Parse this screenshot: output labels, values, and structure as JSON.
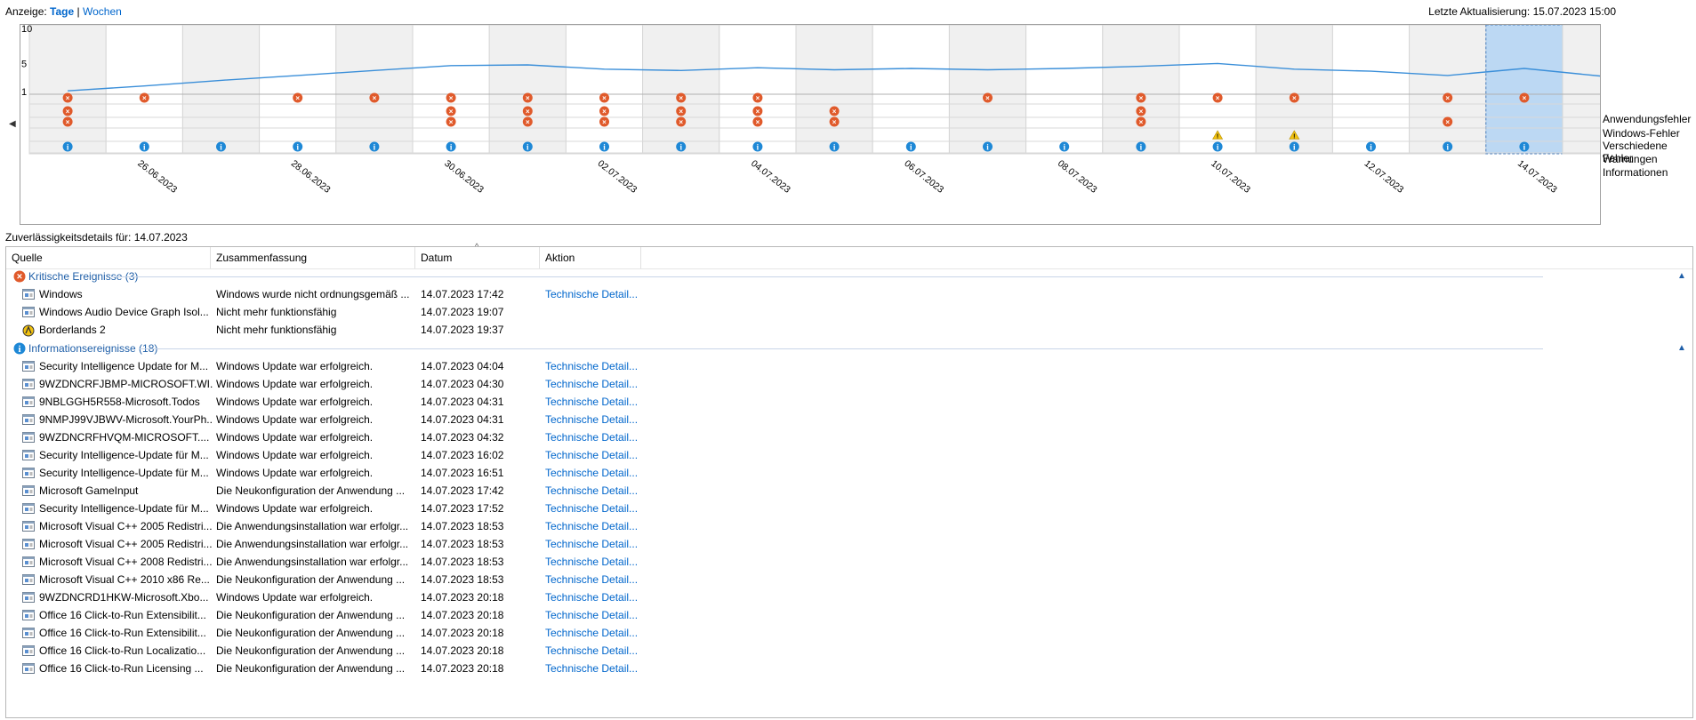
{
  "header": {
    "view_label": "Anzeige:",
    "view_days": "Tage",
    "view_sep": "|",
    "view_weeks": "Wochen",
    "last_update": "Letzte Aktualisierung: 15.07.2023 15:00"
  },
  "chart_data": {
    "type": "line",
    "y_ticks": [
      "10",
      "5",
      "1"
    ],
    "ylim": [
      1,
      10
    ],
    "x": [
      "25.06.2023",
      "26.06.2023",
      "27.06.2023",
      "28.06.2023",
      "29.06.2023",
      "30.06.2023",
      "01.07.2023",
      "02.07.2023",
      "03.07.2023",
      "04.07.2023",
      "05.07.2023",
      "06.07.2023",
      "07.07.2023",
      "08.07.2023",
      "09.07.2023",
      "10.07.2023",
      "11.07.2023",
      "12.07.2023",
      "13.07.2023",
      "14.07.2023",
      "15.07.2023"
    ],
    "x_tick_labels": [
      "26.06.2023",
      "28.06.2023",
      "30.06.2023",
      "02.07.2023",
      "04.07.2023",
      "06.07.2023",
      "08.07.2023",
      "10.07.2023",
      "12.07.2023",
      "14.07.2023"
    ],
    "selected": "14.07.2023",
    "series": [
      {
        "values": [
          1.1,
          1.8,
          2.6,
          3.3,
          4.0,
          4.7,
          4.8,
          4.2,
          4.0,
          4.4,
          4.1,
          4.3,
          4.1,
          4.3,
          4.6,
          5.0,
          4.2,
          3.9,
          3.3,
          4.3,
          3.2
        ]
      }
    ],
    "categories": [
      "Anwendungsfehler",
      "Windows-Fehler",
      "Verschiedene Fehler",
      "Warnungen",
      "Informationen"
    ],
    "events": {
      "Anwendungsfehler": [
        1,
        1,
        0,
        1,
        1,
        1,
        1,
        1,
        1,
        1,
        0,
        0,
        1,
        0,
        1,
        1,
        1,
        0,
        1,
        1,
        0
      ],
      "Windows-Fehler": [
        1,
        0,
        0,
        0,
        0,
        1,
        1,
        1,
        1,
        1,
        1,
        0,
        0,
        0,
        1,
        0,
        0,
        0,
        0,
        0,
        0
      ],
      "Verschiedene Fehler": [
        1,
        0,
        0,
        0,
        0,
        1,
        1,
        1,
        1,
        1,
        1,
        0,
        0,
        0,
        1,
        0,
        0,
        0,
        1,
        0,
        0
      ],
      "Warnungen": [
        0,
        0,
        0,
        0,
        0,
        0,
        0,
        0,
        0,
        0,
        0,
        0,
        0,
        0,
        0,
        1,
        1,
        0,
        0,
        0,
        0
      ],
      "Informationen": [
        1,
        1,
        1,
        1,
        1,
        1,
        1,
        1,
        1,
        1,
        1,
        1,
        1,
        1,
        1,
        1,
        1,
        1,
        1,
        1,
        0
      ]
    }
  },
  "details_title": "Zuverlässigkeitsdetails für: 14.07.2023",
  "columns": [
    "Quelle",
    "Zusammenfassung",
    "Datum",
    "Aktion"
  ],
  "groups": [
    {
      "title": "Kritische Ereignisse (3)",
      "icon": "error-icon",
      "rows": [
        {
          "icon": "window-icon",
          "source": "Windows",
          "summary": "Windows wurde nicht ordnungsgemäß ...",
          "date": "14.07.2023 17:42",
          "action": "Technische Detail..."
        },
        {
          "icon": "window-icon",
          "source": "Windows Audio Device Graph Isol...",
          "summary": "Nicht mehr funktionsfähig",
          "date": "14.07.2023 19:07",
          "action": ""
        },
        {
          "icon": "borderlands-icon",
          "source": "Borderlands 2",
          "summary": "Nicht mehr funktionsfähig",
          "date": "14.07.2023 19:37",
          "action": ""
        }
      ]
    },
    {
      "title": "Informationsereignisse (18)",
      "icon": "info-icon",
      "rows": [
        {
          "icon": "window-icon",
          "source": "Security Intelligence Update for M...",
          "summary": "Windows Update war erfolgreich.",
          "date": "14.07.2023 04:04",
          "action": "Technische Detail..."
        },
        {
          "icon": "window-icon",
          "source": "9WZDNCRFJBMP-MICROSOFT.WI...",
          "summary": "Windows Update war erfolgreich.",
          "date": "14.07.2023 04:30",
          "action": "Technische Detail..."
        },
        {
          "icon": "window-icon",
          "source": "9NBLGGH5R558-Microsoft.Todos",
          "summary": "Windows Update war erfolgreich.",
          "date": "14.07.2023 04:31",
          "action": "Technische Detail..."
        },
        {
          "icon": "window-icon",
          "source": "9NMPJ99VJBWV-Microsoft.YourPh...",
          "summary": "Windows Update war erfolgreich.",
          "date": "14.07.2023 04:31",
          "action": "Technische Detail..."
        },
        {
          "icon": "window-icon",
          "source": "9WZDNCRFHVQM-MICROSOFT....",
          "summary": "Windows Update war erfolgreich.",
          "date": "14.07.2023 04:32",
          "action": "Technische Detail..."
        },
        {
          "icon": "window-icon",
          "source": "Security Intelligence-Update für M...",
          "summary": "Windows Update war erfolgreich.",
          "date": "14.07.2023 16:02",
          "action": "Technische Detail..."
        },
        {
          "icon": "window-icon",
          "source": "Security Intelligence-Update für M...",
          "summary": "Windows Update war erfolgreich.",
          "date": "14.07.2023 16:51",
          "action": "Technische Detail..."
        },
        {
          "icon": "window-icon",
          "source": "Microsoft GameInput",
          "summary": "Die Neukonfiguration der Anwendung ...",
          "date": "14.07.2023 17:42",
          "action": "Technische Detail..."
        },
        {
          "icon": "window-icon",
          "source": "Security Intelligence-Update für M...",
          "summary": "Windows Update war erfolgreich.",
          "date": "14.07.2023 17:52",
          "action": "Technische Detail..."
        },
        {
          "icon": "window-icon",
          "source": "Microsoft Visual C++ 2005 Redistri...",
          "summary": "Die Anwendungsinstallation war erfolgr...",
          "date": "14.07.2023 18:53",
          "action": "Technische Detail..."
        },
        {
          "icon": "window-icon",
          "source": "Microsoft Visual C++ 2005 Redistri...",
          "summary": "Die Anwendungsinstallation war erfolgr...",
          "date": "14.07.2023 18:53",
          "action": "Technische Detail..."
        },
        {
          "icon": "window-icon",
          "source": "Microsoft Visual C++ 2008 Redistri...",
          "summary": "Die Anwendungsinstallation war erfolgr...",
          "date": "14.07.2023 18:53",
          "action": "Technische Detail..."
        },
        {
          "icon": "window-icon",
          "source": "Microsoft Visual C++ 2010  x86 Re...",
          "summary": "Die Neukonfiguration der Anwendung ...",
          "date": "14.07.2023 18:53",
          "action": "Technische Detail..."
        },
        {
          "icon": "window-icon",
          "source": "9WZDNCRD1HKW-Microsoft.Xbo...",
          "summary": "Windows Update war erfolgreich.",
          "date": "14.07.2023 20:18",
          "action": "Technische Detail..."
        },
        {
          "icon": "window-icon",
          "source": "Office 16 Click-to-Run Extensibilit...",
          "summary": "Die Neukonfiguration der Anwendung ...",
          "date": "14.07.2023 20:18",
          "action": "Technische Detail..."
        },
        {
          "icon": "window-icon",
          "source": "Office 16 Click-to-Run Extensibilit...",
          "summary": "Die Neukonfiguration der Anwendung ...",
          "date": "14.07.2023 20:18",
          "action": "Technische Detail..."
        },
        {
          "icon": "window-icon",
          "source": "Office 16 Click-to-Run Localizatio...",
          "summary": "Die Neukonfiguration der Anwendung ...",
          "date": "14.07.2023 20:18",
          "action": "Technische Detail..."
        },
        {
          "icon": "window-icon",
          "source": "Office 16 Click-to-Run Licensing ...",
          "summary": "Die Neukonfiguration der Anwendung ...",
          "date": "14.07.2023 20:18",
          "action": "Technische Detail..."
        }
      ]
    }
  ],
  "colors": {
    "error": "#e05a2b",
    "info": "#1e88d6",
    "warning": "#f2c20f",
    "line": "#3b8fd9",
    "selected": "#bcd8f3",
    "alt_column": "#f0f0f0"
  }
}
